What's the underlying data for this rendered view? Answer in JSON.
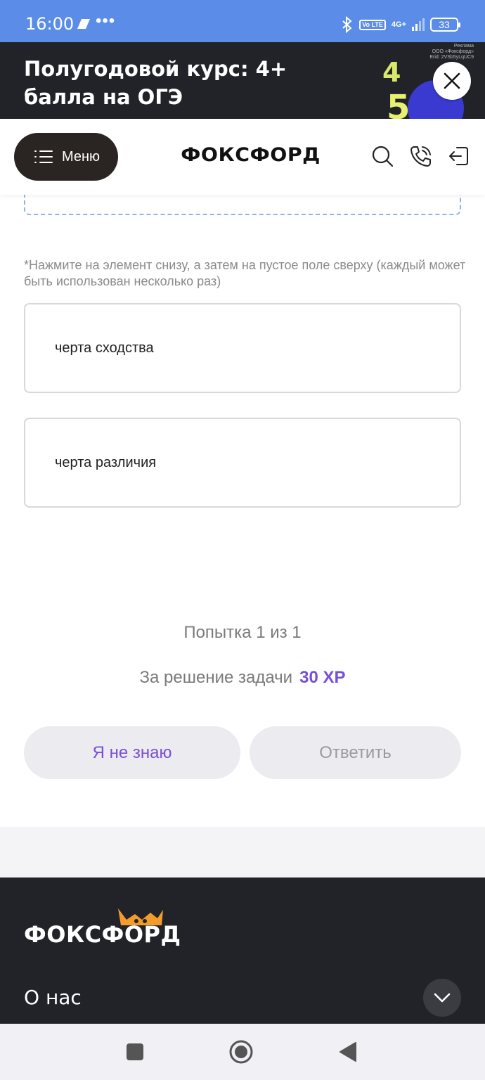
{
  "status_bar": {
    "time": "16:00",
    "dots": "•••",
    "bluetooth_icon": "bluetooth-icon",
    "volte": "Vo LTE",
    "network": "4G+",
    "battery": "33"
  },
  "ad": {
    "title": "Полугодовой курс: 4+ балла на ОГЭ",
    "legal_1": "Реклама",
    "legal_2": "ООО «Фоксфорд»",
    "legal_3": "Erid: 2VSb5yLqUC9",
    "art_digit_1": "4",
    "art_digit_2": "5"
  },
  "header": {
    "menu_label": "Меню",
    "logo": "ФОКСФОРД"
  },
  "task": {
    "hint": "*Нажмите на элемент снизу, а затем на пустое поле сверху (каждый может быть использован несколько раз)",
    "options": [
      {
        "label": "черта сходства"
      },
      {
        "label": "черта различия"
      }
    ],
    "attempt": "Попытка 1 из 1",
    "reward_label": "За решение задачи",
    "reward_value": "30 XP",
    "idk_button": "Я не знаю",
    "answer_button": "Ответить"
  },
  "footer": {
    "logo": "ФОКСФОРД",
    "about": "О нас"
  },
  "colors": {
    "status_bar": "#5b8de8",
    "accent_purple": "#7a4fd6",
    "dark": "#222329",
    "fox_orange": "#f39c2c"
  }
}
